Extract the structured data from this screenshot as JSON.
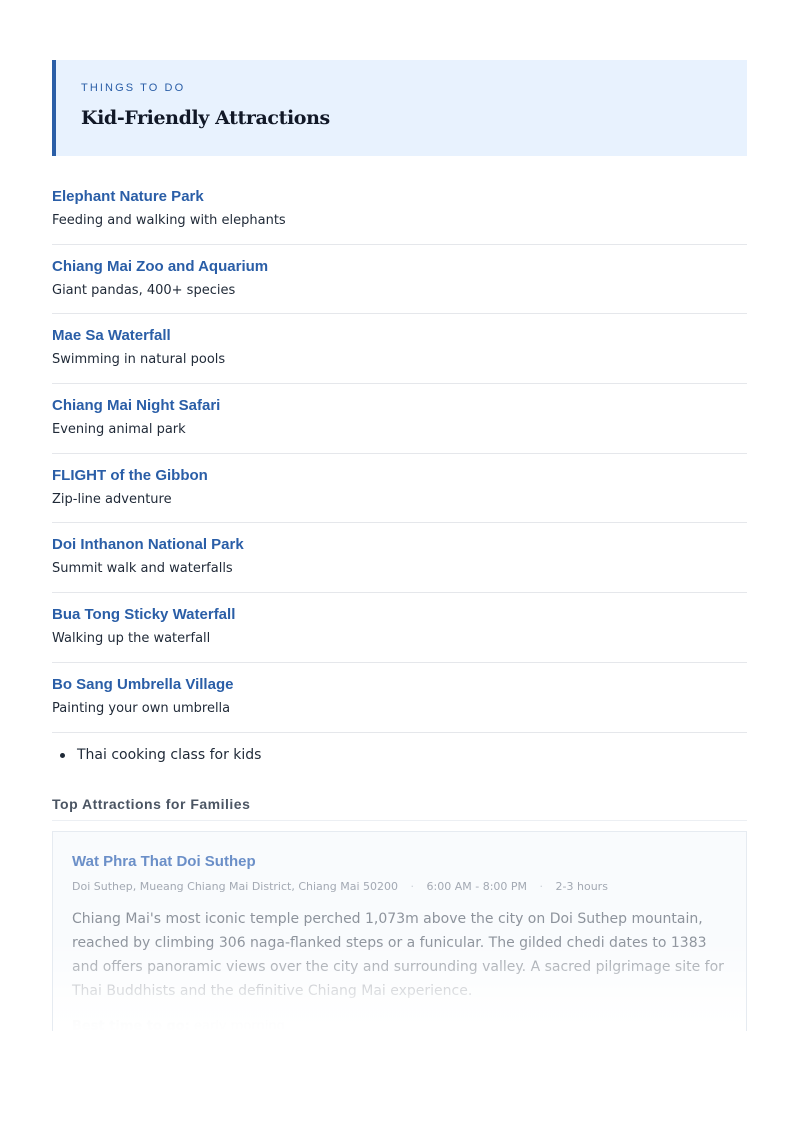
{
  "header": {
    "eyebrow": "THINGS TO DO",
    "title": "Kid-Friendly Attractions"
  },
  "attractions": [
    {
      "name": "Elephant Nature Park",
      "desc": "Feeding and walking with elephants"
    },
    {
      "name": "Chiang Mai Zoo and Aquarium",
      "desc": "Giant pandas, 400+ species"
    },
    {
      "name": "Mae Sa Waterfall",
      "desc": "Swimming in natural pools"
    },
    {
      "name": "Chiang Mai Night Safari",
      "desc": "Evening animal park"
    },
    {
      "name": "FLIGHT of the Gibbon",
      "desc": "Zip-line adventure"
    },
    {
      "name": "Doi Inthanon National Park",
      "desc": "Summit walk and waterfalls"
    },
    {
      "name": "Bua Tong Sticky Waterfall",
      "desc": "Walking up the waterfall"
    },
    {
      "name": "Bo Sang Umbrella Village",
      "desc": "Painting your own umbrella"
    }
  ],
  "extras": [
    "Thai cooking class for kids"
  ],
  "section": {
    "heading": "Top Attractions for Families"
  },
  "card": {
    "title": "Wat Phra That Doi Suthep",
    "address": "Doi Suthep, Mueang Chiang Mai District, Chiang Mai 50200",
    "hours": "6:00 AM - 8:00 PM",
    "duration": "2-3 hours",
    "description": "Chiang Mai's most iconic temple perched 1,073m above the city on Doi Suthep mountain, reached by climbing 306 naga-flanked steps or a funicular. The gilded chedi dates to 1383 and offers panoramic views over the city and surrounding valley. A sacred pilgrimage site for Thai Buddhists and the definitive Chiang Mai experience.",
    "best_time_label": "Best time to go:",
    "best_time_value": "early morning",
    "separator": "·"
  },
  "colors": {
    "accent": "#2a5ea7",
    "header_bg": "#e8f2fe",
    "text": "#1f2937",
    "divider": "#e5e7eb"
  }
}
